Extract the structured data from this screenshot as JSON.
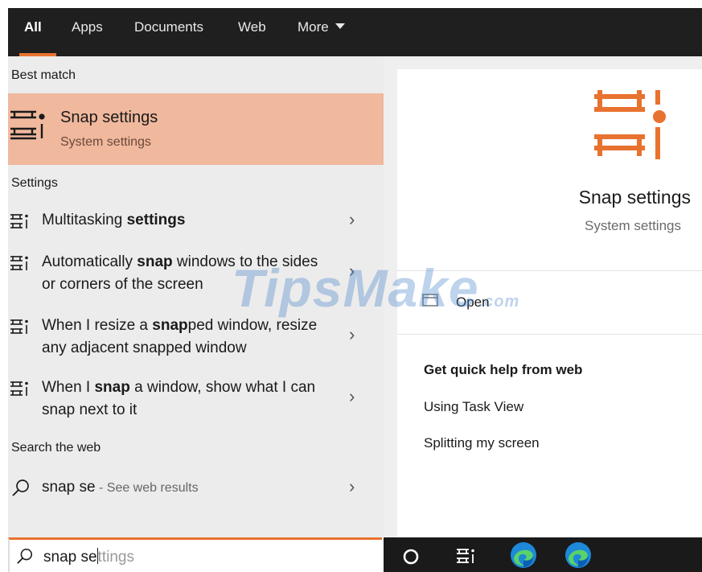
{
  "tabs": [
    {
      "label": "All",
      "active": true
    },
    {
      "label": "Apps"
    },
    {
      "label": "Documents"
    },
    {
      "label": "Web"
    },
    {
      "label": "More"
    }
  ],
  "left": {
    "best_match_heading": "Best match",
    "best_match": {
      "title": "Snap settings",
      "subtitle": "System settings",
      "icon": "snap-layout-icon"
    },
    "settings_heading": "Settings",
    "settings_items": [
      {
        "pre": "Multitasking ",
        "bold": "settings",
        "post": ""
      },
      {
        "pre": "Automatically ",
        "bold": "snap",
        "post": " windows to the sides or corners of the screen"
      },
      {
        "pre": "When I resize a ",
        "bold": "snap",
        "post": "ped window, resize any adjacent snapped window"
      },
      {
        "pre": "When I ",
        "bold": "snap",
        "post": " a window, show what I can snap next to it"
      }
    ],
    "web_heading": "Search the web",
    "web_item": {
      "query": "snap se",
      "suffix": " - See web results"
    }
  },
  "right": {
    "title": "Snap settings",
    "subtitle": "System settings",
    "open_label": "Open",
    "help_heading": "Get quick help from web",
    "help_links": [
      "Using Task View",
      "Splitting my screen"
    ]
  },
  "search": {
    "typed": "snap se",
    "ghost": "ttings"
  },
  "watermark": {
    "text": "TipsMake",
    "suffix": ".com"
  },
  "colors": {
    "accent": "#e8722f",
    "best_match_bg": "#f0b89d",
    "tabbar_bg": "#1f1f1f"
  },
  "taskbar": [
    "cortana-circle-icon",
    "task-view-icon",
    "edge-icon",
    "edge-icon"
  ]
}
